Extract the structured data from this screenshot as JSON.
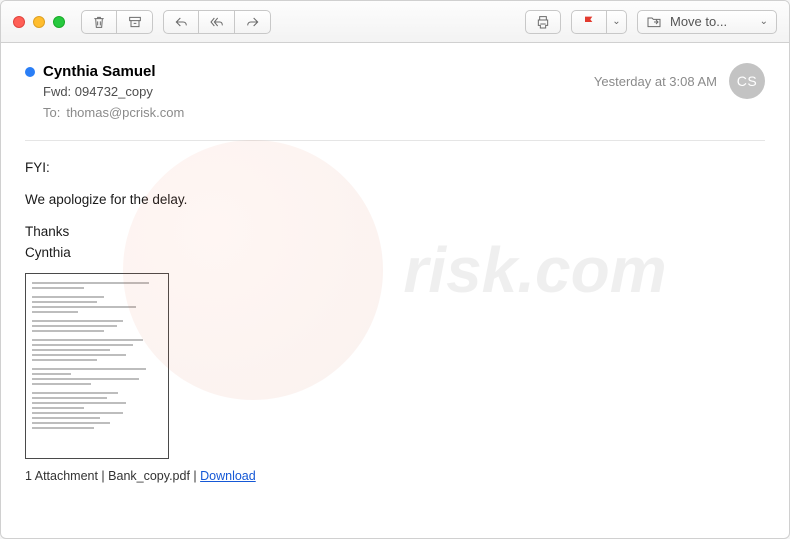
{
  "toolbar": {
    "moveto_label": "Move to..."
  },
  "header": {
    "sender": "Cynthia Samuel",
    "subject": "Fwd: 094732_copy",
    "to_label": "To:",
    "to_value": "thomas@pcrisk.com",
    "timestamp": "Yesterday at 3:08 AM",
    "initials": "CS"
  },
  "body": {
    "line1": "FYI:",
    "line2": "We apologize for the delay.",
    "sig1": "Thanks",
    "sig2": "Cynthia"
  },
  "attachment": {
    "summary": "1 Attachment | Bank_copy.pdf | ",
    "download": "Download"
  }
}
